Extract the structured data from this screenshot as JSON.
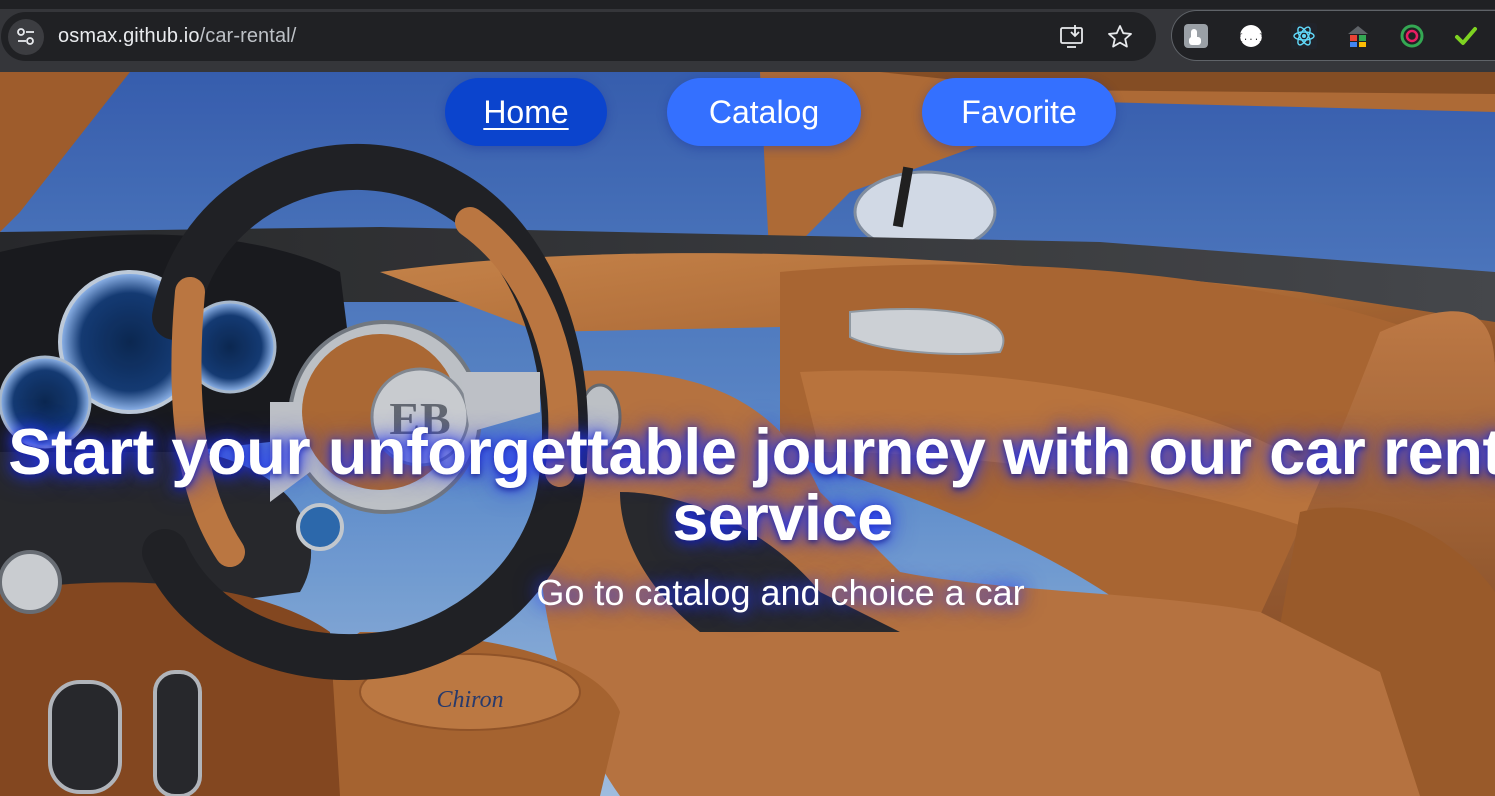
{
  "browser": {
    "url_host": "osmax.github.io",
    "url_path": "/car-rental/",
    "icons": {
      "site_info": "tune-icon",
      "install": "install-app-icon",
      "bookmark": "star-icon",
      "extensions": [
        "touch-extension-icon",
        "json-extension-icon",
        "react-devtools-icon",
        "colorful-extension-icon",
        "ring-extension-icon",
        "check-extension-icon"
      ]
    }
  },
  "nav": {
    "home": "Home",
    "catalog": "Catalog",
    "favorite": "Favorite",
    "active": "Home"
  },
  "hero": {
    "title": "Start your unforgettable journey with our car rental service",
    "subtitle": "Go to catalog and choice a car",
    "background": "car-interior-image"
  },
  "colors": {
    "nav_button": "#3470ff",
    "nav_button_active": "#0b44cd",
    "text": "#ffffff",
    "title_glow": "#2840ff"
  }
}
